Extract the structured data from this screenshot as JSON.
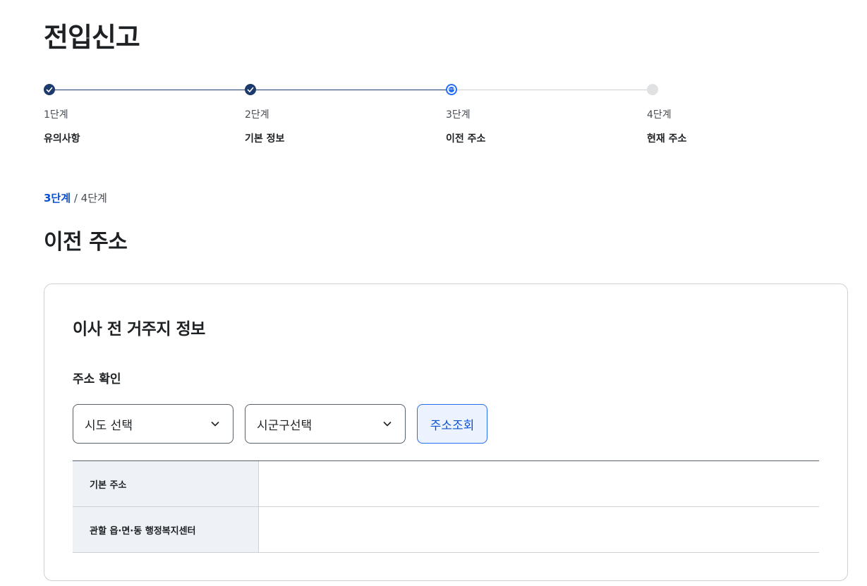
{
  "page": {
    "title": "전입신고"
  },
  "stepper": {
    "steps": [
      {
        "number": "1단계",
        "label": "유의사항",
        "status": "done"
      },
      {
        "number": "2단계",
        "label": "기본 정보",
        "status": "done"
      },
      {
        "number": "3단계",
        "label": "이전 주소",
        "status": "current"
      },
      {
        "number": "4단계",
        "label": "현재 주소",
        "status": "todo"
      }
    ]
  },
  "section": {
    "current_step": "3단계",
    "separator": "/",
    "total_step": "4단계",
    "title": "이전 주소"
  },
  "card": {
    "title": "이사 전 거주지 정보",
    "field_label": "주소 확인",
    "sido_select": {
      "value": "시도 선택"
    },
    "sigungu_select": {
      "value": "시군구선택"
    },
    "search_button": "주소조회",
    "rows": [
      {
        "header": "기본 주소",
        "value": ""
      },
      {
        "header": "관할 읍·면·동 행정복지센터",
        "value": ""
      }
    ]
  },
  "colors": {
    "done": "#1c3a6b",
    "current": "#256ef4",
    "todo": "#dfe1e3",
    "accent_text": "#0b50d0",
    "table_header_bg": "#eef2f7",
    "button_bg": "#ecf2fe"
  },
  "icons": {
    "done_step": "check-icon",
    "current_step": "ellipsis-icon",
    "select": "chevron-down-icon"
  }
}
